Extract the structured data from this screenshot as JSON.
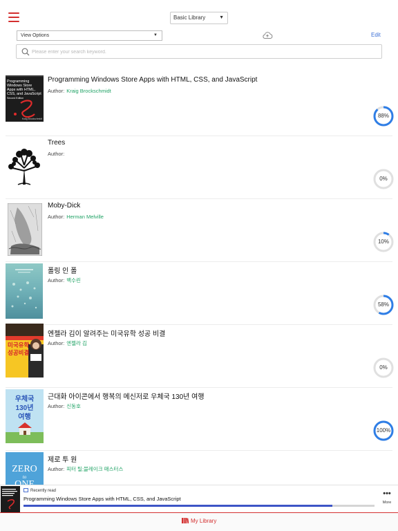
{
  "header": {
    "library_select": "Basic Library"
  },
  "toolbar": {
    "view_options": "View Options",
    "edit_label": "Edit",
    "search_placeholder": "Please enter your search keyword."
  },
  "books": [
    {
      "title": "Programming Windows Store Apps with HTML, CSS, and JavaScript",
      "author_label": "Author:",
      "author": "Kraig Brockschmidt",
      "progress_percent": 88,
      "progress_label": "88%"
    },
    {
      "title": "Trees",
      "author_label": "Author:",
      "author": "",
      "progress_percent": 0,
      "progress_label": "0%"
    },
    {
      "title": "Moby-Dick",
      "author_label": "Author:",
      "author": "Herman Melville",
      "progress_percent": 10,
      "progress_label": "10%"
    },
    {
      "title": "폴링 인 폴",
      "author_label": "Author:",
      "author": "백수린",
      "progress_percent": 58,
      "progress_label": "58%"
    },
    {
      "title": "엔젤라 김이 알려주는 미국유학 성공 비결",
      "author_label": "Author:",
      "author": "엔젤라 김",
      "progress_percent": 0,
      "progress_label": "0%"
    },
    {
      "title": "근대화 아이콘에서 행복의 메신저로 우체국 130년 여행",
      "author_label": "Author:",
      "author": "신동호",
      "progress_percent": 100,
      "progress_label": "100%"
    },
    {
      "title": "제로 투 원",
      "author_label": "Author:",
      "author": "피터 틸;블레이크 매스터스",
      "progress_percent": 0,
      "progress_label": ""
    }
  ],
  "covers": {
    "book1": {
      "line1": "Programming",
      "line2": "Windows Store",
      "line3": "Apps with HTML,",
      "line4": "CSS, and JavaScript",
      "line5": "Second Edition",
      "author": "Kraig Brockschmidt"
    },
    "book5": {
      "line1": "미국유학",
      "line2": "성공비결"
    },
    "book6": {
      "line1": "우체국",
      "line2": "130년",
      "line3": "여행"
    },
    "book7": {
      "line1": "ZERO",
      "line2": "to",
      "line3": "ONE"
    }
  },
  "recently_read": {
    "label": "Recently read",
    "title": "Programming Windows Store Apps with HTML, CSS, and JavaScript",
    "progress_percent": 88,
    "more_label": "More"
  },
  "bottom_nav": {
    "my_library": "My Library"
  },
  "colors": {
    "accent_red": "#d32f2f",
    "progress_blue": "#2f7ee6",
    "author_green": "#21a366",
    "link_blue": "#3b6fd6"
  },
  "icons": [
    "hamburger-menu-icon",
    "cloud-sync-icon",
    "search-icon",
    "bookmark-icon",
    "more-dots-icon",
    "books-icon"
  ]
}
